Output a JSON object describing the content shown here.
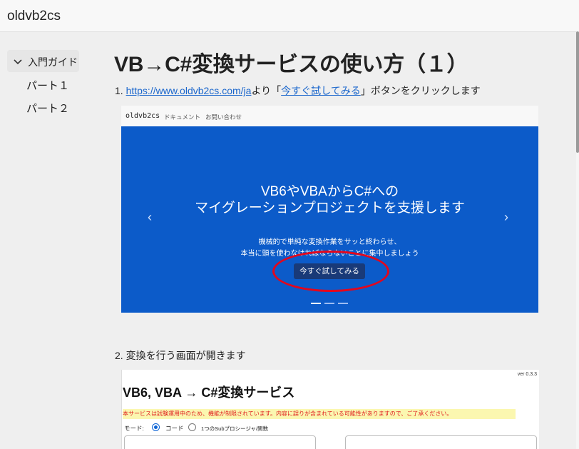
{
  "app": {
    "brand": "oldvb2cs"
  },
  "sidebar": {
    "section_label": "入門ガイド",
    "items": [
      {
        "label": "パート１"
      },
      {
        "label": "パート２"
      }
    ]
  },
  "main": {
    "title": "VB→C#変換サービスの使い方（１）",
    "step1": {
      "number": "1. ",
      "link": "https://www.oldvb2cs.com/ja",
      "text_mid": "より「",
      "button_link": "今すぐ試してみる",
      "text_end": "」ボタンをクリックします"
    },
    "step2": {
      "text": "2. 変換を行う画面が開きます"
    }
  },
  "screenshot1": {
    "nav_brand": "oldvb2cs",
    "nav_items": [
      "ドキュメント",
      "お問い合わせ"
    ],
    "headline_line1": "VB6やVBAからC#への",
    "headline_line2": "マイグレーションプロジェクトを支援します",
    "sub_line1": "機械的で単純な変換作業をサッと終わらせ、",
    "sub_line2": "本当に頭を使わなければならないことに集中しましょう",
    "cta": "今すぐ試してみる",
    "carousel_slides": 3,
    "highlight_color": "#e3071d"
  },
  "screenshot2": {
    "version": "ver 0.3.3",
    "title": "VB6, VBA → C#変換サービス",
    "warning": "本サービスは試験運用中のため、機能が制限されています。内容に誤りが含まれている可能性がありますので、ご了承ください。",
    "mode_label": "モード:",
    "mode_option1": "コード",
    "mode_option2": "1つのSubプロシージャ/関数",
    "selected_mode": "コード"
  }
}
